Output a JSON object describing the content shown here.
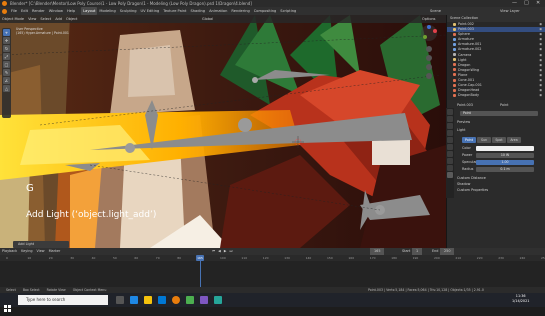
{
  "window": {
    "title": "Blender* [C:\\Blender\\Mentor\\Low Poly Course\\1 - Low Poly Dragon\\1 - Modeling (Low Poly Dragon).psd 1\\Dragon\\4.blend]",
    "controls": [
      "—",
      "□",
      "✕"
    ]
  },
  "menubar": {
    "items": [
      "File",
      "Edit",
      "Render",
      "Window",
      "Help"
    ],
    "workspaces": [
      "Layout",
      "Modeling",
      "Sculpting",
      "UV Editing",
      "Texture Paint",
      "Shading",
      "Animation",
      "Rendering",
      "Compositing",
      "Scripting"
    ],
    "active_workspace": "Layout",
    "scene": "Scene",
    "view_layer": "View Layer"
  },
  "viewport": {
    "header_items": [
      "Object Mode",
      "View",
      "Select",
      "Add",
      "Object",
      "Global",
      "Options"
    ],
    "info_line1": "User Perspective",
    "info_line2": "(165) Hyper.Armature | Point.001",
    "shortcut_key": "G",
    "operator_caption": "Add Light (‘object.light_add’)",
    "last_op_panel": "Add Light",
    "tools": [
      "⌖",
      "✛",
      "↻",
      "⤢",
      "□",
      "✎",
      "∠",
      "△"
    ]
  },
  "outliner": {
    "header": "Scene Collection",
    "rows": [
      {
        "label": "Point.002",
        "color": "#e0c070",
        "selected": false
      },
      {
        "label": "Point.003",
        "color": "#e0c070",
        "selected": true
      },
      {
        "label": "Sphere",
        "color": "#e07050",
        "selected": false
      },
      {
        "label": "Armature",
        "color": "#6fa0e0",
        "selected": false
      },
      {
        "label": "Armature.001",
        "color": "#6fa0e0",
        "selected": false
      },
      {
        "label": "Armature.002",
        "color": "#6fa0e0",
        "selected": false
      },
      {
        "label": "Camera",
        "color": "#b0b0b0",
        "selected": false
      },
      {
        "label": "Light",
        "color": "#e0c070",
        "selected": false
      },
      {
        "label": "Dragon",
        "color": "#e07050",
        "selected": false
      },
      {
        "label": "DragonWing",
        "color": "#e07050",
        "selected": false
      },
      {
        "label": "Plane",
        "color": "#e07050",
        "selected": false
      },
      {
        "label": "Cone.001",
        "color": "#e07050",
        "selected": false
      },
      {
        "label": "Cone.Cap.001",
        "color": "#e07050",
        "selected": false
      },
      {
        "label": "DragonHead",
        "color": "#e07050",
        "selected": false
      },
      {
        "label": "DragonBody",
        "color": "#e07050",
        "selected": false
      }
    ]
  },
  "properties": {
    "breadcrumb": "Point.003",
    "breadcrumb2": "Point",
    "name": "Point",
    "sections": [
      "Preview",
      "Light"
    ],
    "light_types": [
      "Point",
      "Sun",
      "Spot",
      "Area"
    ],
    "active_light_type": "Point",
    "fields": [
      {
        "label": "Color",
        "value": ""
      },
      {
        "label": "Power",
        "value": "10 W"
      },
      {
        "label": "Specular",
        "value": "1.00"
      },
      {
        "label": "Radius",
        "value": "0.1 m"
      }
    ],
    "extra_sections": [
      "Custom Distance",
      "Shadow",
      "Custom Properties"
    ]
  },
  "timeline": {
    "header_items": [
      "Playback",
      "Keying",
      "View",
      "Marker"
    ],
    "start_label": "Start",
    "start": "1",
    "end_label": "End",
    "end": "250",
    "current_frame": "165",
    "ticks": [
      "0",
      "10",
      "20",
      "30",
      "40",
      "50",
      "60",
      "70",
      "80",
      "90",
      "100",
      "110",
      "120",
      "130",
      "140",
      "150",
      "160",
      "170",
      "180",
      "190",
      "200",
      "210",
      "220",
      "230",
      "240",
      "250"
    ]
  },
  "statusbar": {
    "items": [
      "Select",
      "Box Select",
      "Rotate View",
      "Object Context Menu"
    ],
    "stats": "Point.003 | Verts:5,184 | Faces:5,064 | Tris:10,128 | Objects:1/35 | 2.91.0"
  },
  "taskbar": {
    "search_placeholder": "Type here to search",
    "time": "11:36",
    "date": "1/14/2021"
  }
}
